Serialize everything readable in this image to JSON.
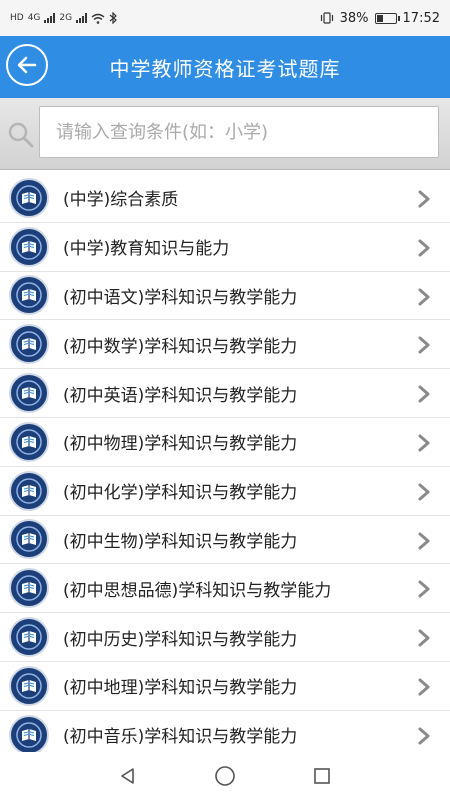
{
  "status_bar": {
    "network_1": "HD",
    "network_2": "4G",
    "network_3": "2G",
    "battery_percent": "38%",
    "battery_level": 0.38,
    "time": "17:52"
  },
  "header": {
    "title": "中学教师资格证考试题库"
  },
  "search": {
    "placeholder": "请输入查询条件(如：小学)"
  },
  "list": {
    "items": [
      {
        "label": "(中学)综合素质"
      },
      {
        "label": "(中学)教育知识与能力"
      },
      {
        "label": "(初中语文)学科知识与教学能力"
      },
      {
        "label": "(初中数学)学科知识与教学能力"
      },
      {
        "label": "(初中英语)学科知识与教学能力"
      },
      {
        "label": "(初中物理)学科知识与教学能力"
      },
      {
        "label": "(初中化学)学科知识与教学能力"
      },
      {
        "label": "(初中生物)学科知识与教学能力"
      },
      {
        "label": "(初中思想品德)学科知识与教学能力"
      },
      {
        "label": "(初中历史)学科知识与教学能力"
      },
      {
        "label": "(初中地理)学科知识与教学能力"
      },
      {
        "label": "(初中音乐)学科知识与教学能力"
      }
    ]
  },
  "icons": {
    "back": "back-arrow-icon",
    "search": "search-icon",
    "item_logo": "book-emblem-icon",
    "item_chevron": "chevron-right-icon",
    "nav_back": "triangle-back-icon",
    "nav_home": "circle-home-icon",
    "nav_recent": "square-recent-icon"
  },
  "colors": {
    "header_bg": "#2f8de4",
    "header_text": "#ffffff",
    "logo_bg": "#1c3f7a"
  }
}
